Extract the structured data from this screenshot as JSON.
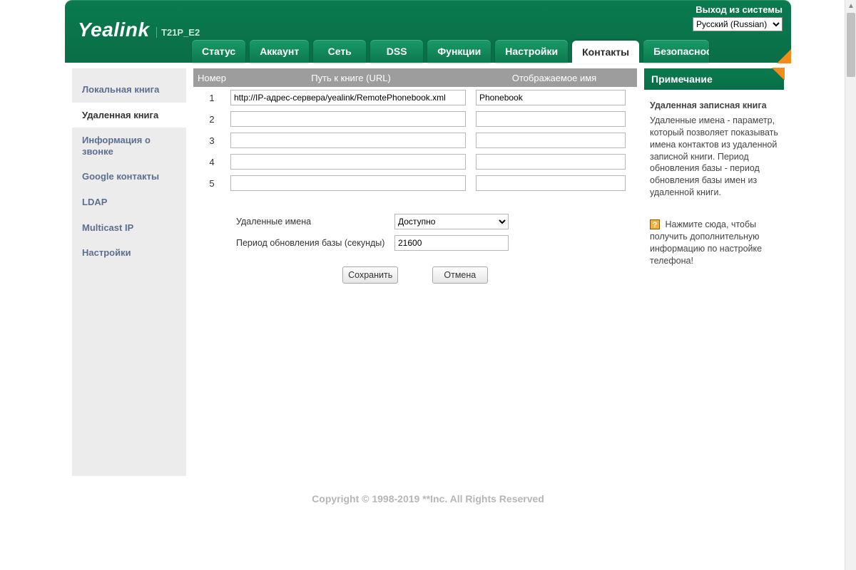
{
  "header": {
    "logout": "Выход из системы",
    "language_selected": "Русский (Russian)",
    "logo": "Yealink",
    "model": "T21P_E2"
  },
  "tabs": [
    {
      "label": "Статус"
    },
    {
      "label": "Аккаунт"
    },
    {
      "label": "Сеть"
    },
    {
      "label": "DSS"
    },
    {
      "label": "Функции"
    },
    {
      "label": "Настройки"
    },
    {
      "label": "Контакты",
      "active": true
    },
    {
      "label": "Безопасность"
    }
  ],
  "sidebar": [
    {
      "label": "Локальная книга"
    },
    {
      "label": "Удаленная книга",
      "active": true
    },
    {
      "label": "Информация о звонке"
    },
    {
      "label": "Google контакты"
    },
    {
      "label": "LDAP"
    },
    {
      "label": "Multicast IP"
    },
    {
      "label": "Настройки"
    }
  ],
  "table": {
    "head": {
      "num": "Номер",
      "url": "Путь к книге (URL)",
      "name": "Отображаемое имя"
    },
    "rows": [
      {
        "n": "1",
        "url": "http://IP-адрес-сервера/yealink/RemotePhonebook.xml",
        "name": "Phonebook"
      },
      {
        "n": "2",
        "url": "",
        "name": ""
      },
      {
        "n": "3",
        "url": "",
        "name": ""
      },
      {
        "n": "4",
        "url": "",
        "name": ""
      },
      {
        "n": "5",
        "url": "",
        "name": ""
      }
    ]
  },
  "options": {
    "remote_names_label": "Удаленные имена",
    "remote_names_value": "Доступно",
    "refresh_label": "Период обновления базы (секунды)",
    "refresh_value": "21600"
  },
  "buttons": {
    "save": "Сохранить",
    "cancel": "Отмена"
  },
  "note": {
    "title": "Примечание",
    "heading": "Удаленная записная книга",
    "text": "Удаленные имена - параметр, который позволяет показывать имена контактов из удаленной записной книги. Период обновления базы - период обновления базы имен из удаленной книги.",
    "link": "Нажмите сюда, чтобы получить дополнительную информацию по настройке телефона!"
  },
  "footer": "Copyright © 1998-2019 **Inc. All Rights Reserved"
}
